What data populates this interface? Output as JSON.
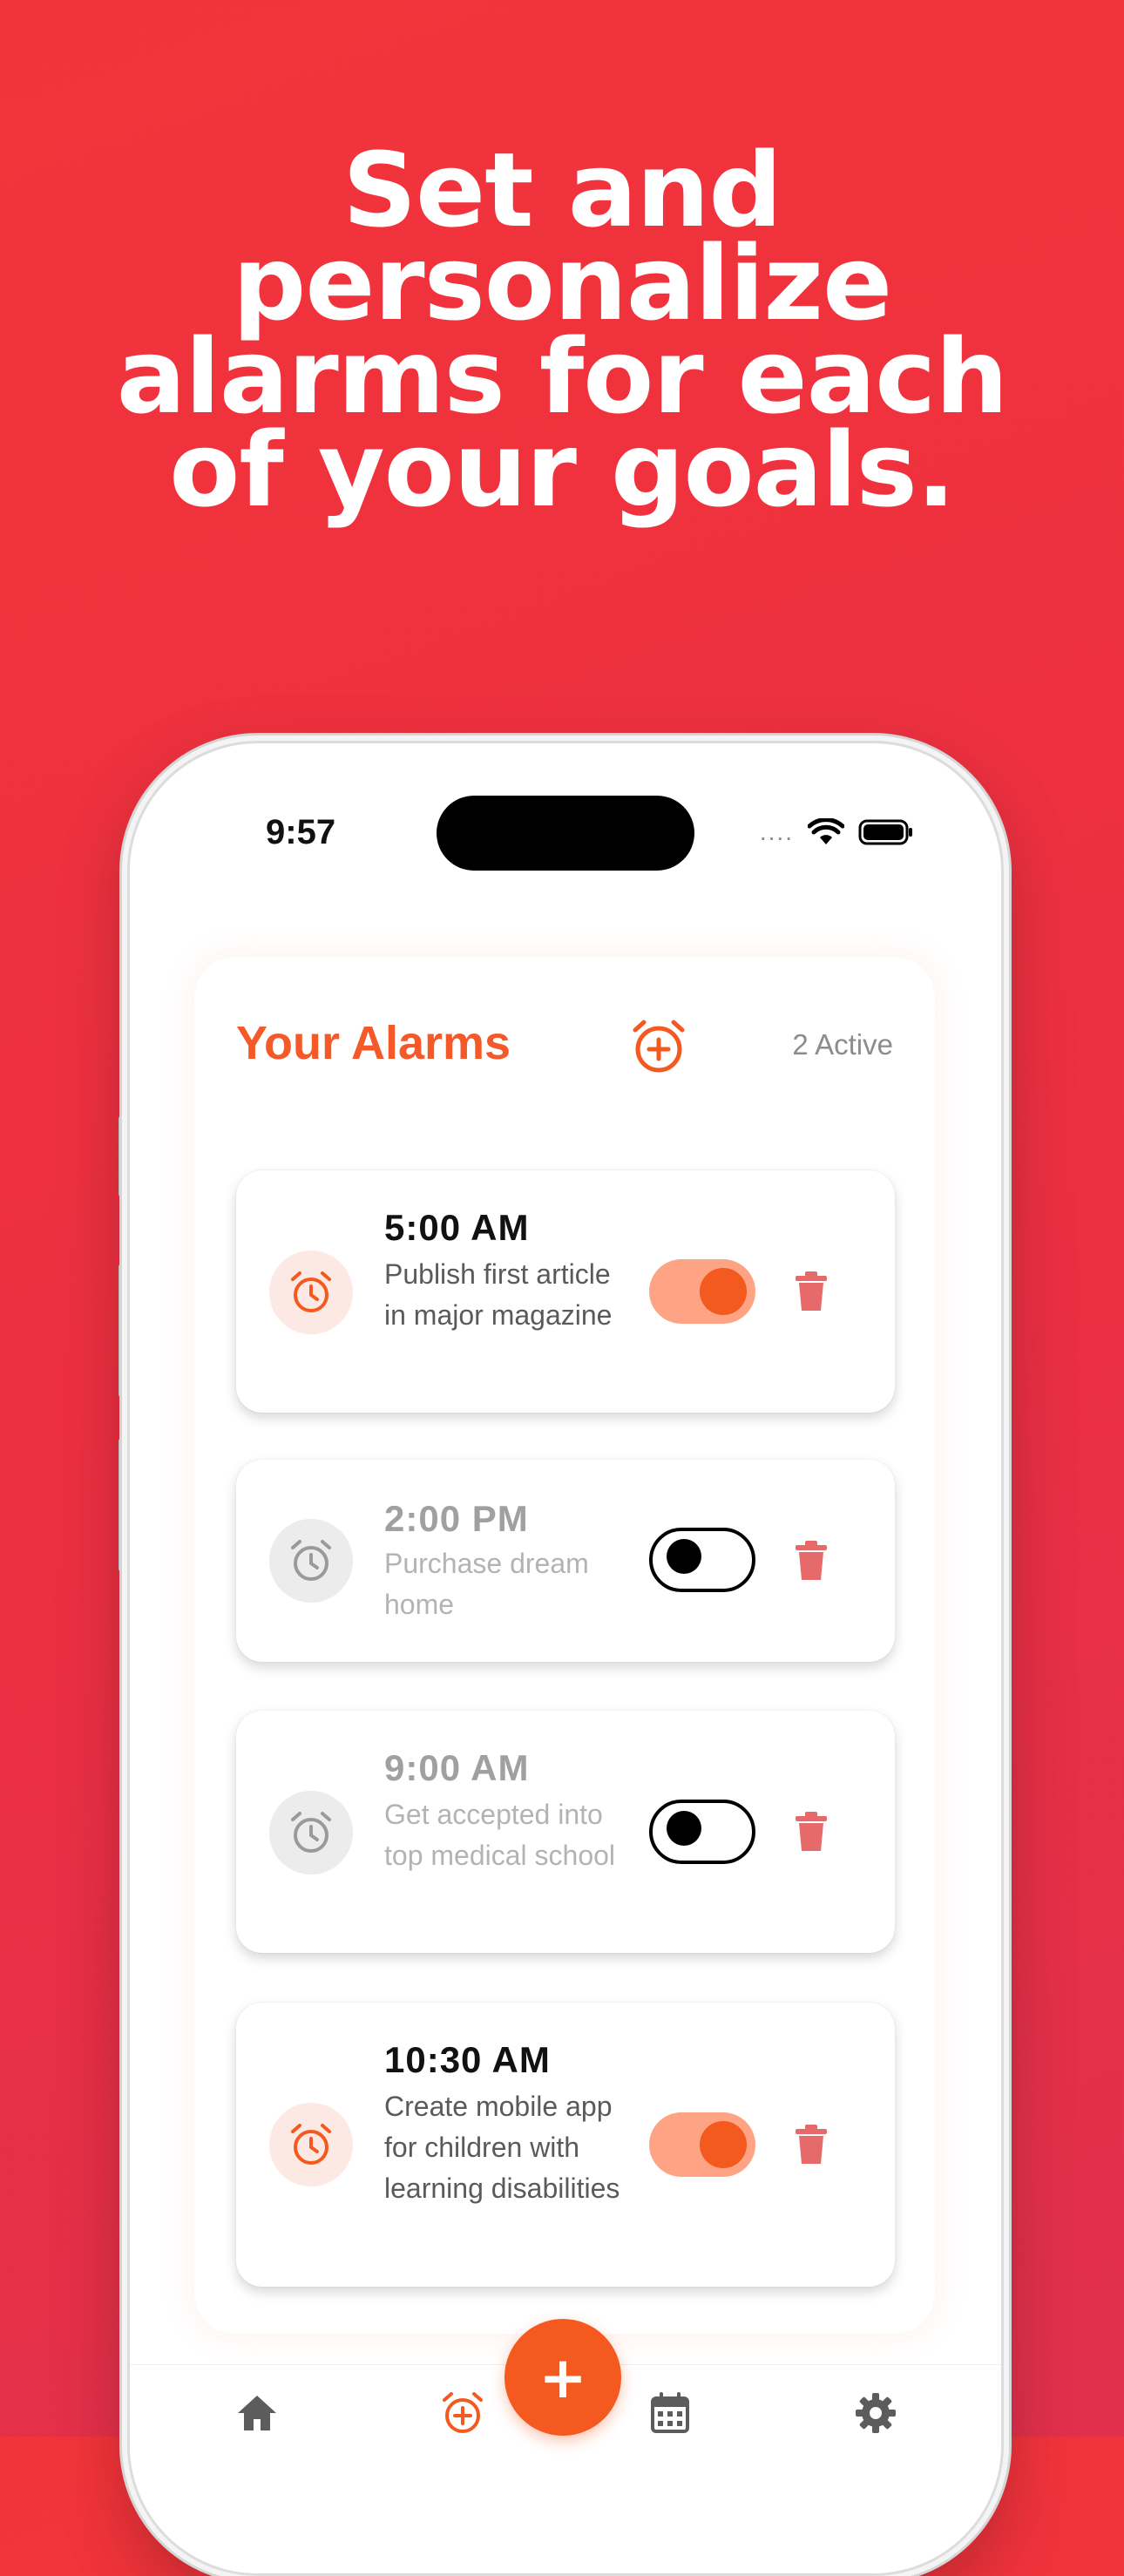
{
  "headline": {
    "lines": [
      "Set and",
      "personalize",
      "alarms for each",
      "of your goals."
    ]
  },
  "status_bar": {
    "time": "9:57",
    "signal": "....",
    "icons": [
      "wifi-icon",
      "battery-icon"
    ]
  },
  "panel": {
    "title": "Your Alarms",
    "active_count": "2 Active",
    "add_icon": "alarm-add-icon"
  },
  "alarms": [
    {
      "time": "5:00 AM",
      "description": "Publish first article in major magazine",
      "enabled": true
    },
    {
      "time": "2:00 PM",
      "description": "Purchase dream home",
      "enabled": false
    },
    {
      "time": "9:00 AM",
      "description": "Get accepted into top medical school",
      "enabled": false
    },
    {
      "time": "10:30 AM",
      "description": "Create mobile app for children with learning disabilities",
      "enabled": true
    }
  ],
  "nav": {
    "items": [
      "home-icon",
      "alarm-add-icon",
      "calendar-icon",
      "settings-icon"
    ],
    "fab_label": "+"
  },
  "colors": {
    "background": "#ee3040",
    "accent": "#f4591f",
    "toggle_on_track": "#ffa385",
    "trash": "#e76a6a"
  }
}
